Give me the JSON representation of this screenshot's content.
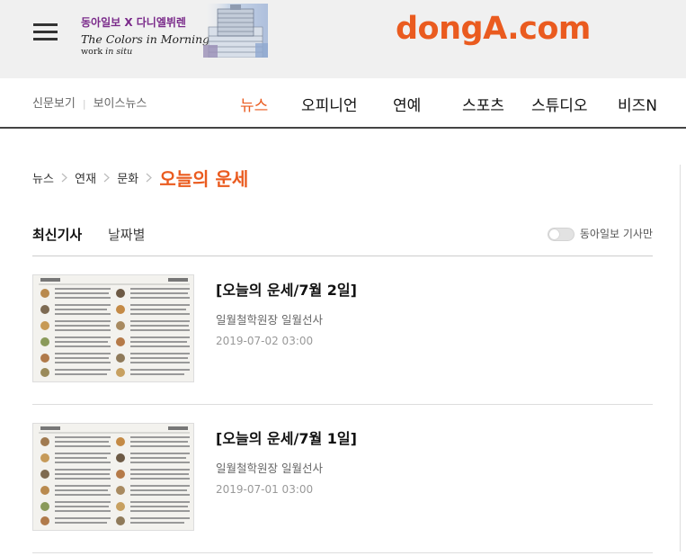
{
  "header": {
    "banner_top": "동아일보 X 다니엘뷔렌",
    "banner_mid": "The Colors in Morning Calm",
    "banner_bot_a": "work ",
    "banner_bot_b": "in situ",
    "logo": "dongA.com"
  },
  "nav": {
    "left_items": [
      "신문보기",
      "보이스뉴스"
    ],
    "items": [
      "뉴스",
      "오피니언",
      "연예",
      "스포츠",
      "스튜디오",
      "비즈N"
    ],
    "active": "뉴스"
  },
  "breadcrumb": {
    "items": [
      "뉴스",
      "연재",
      "문화"
    ],
    "current": "오늘의 운세"
  },
  "tabs": {
    "latest": "최신기사",
    "by_date": "날짜별",
    "toggle_label": "동아일보 기사만"
  },
  "articles": [
    {
      "title": "[오늘의 운세/7월 2일]",
      "author": "일월철학원장 일월선사",
      "date": "2019-07-02 03:00"
    },
    {
      "title": "[오늘의 운세/7월 1일]",
      "author": "일월철학원장 일월선사",
      "date": "2019-07-01 03:00"
    }
  ],
  "colors": {
    "accent": "#ea5b1f",
    "header_bg": "#f0f0f0",
    "text": "#111111"
  },
  "icons": [
    "hamburger-menu-icon",
    "chevron-right-icon",
    "toggle-switch"
  ]
}
